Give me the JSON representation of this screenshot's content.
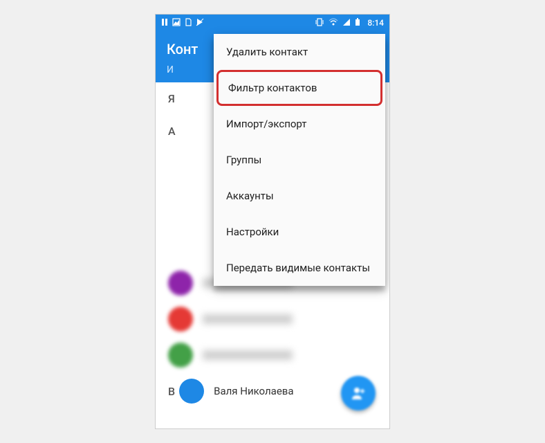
{
  "status_bar": {
    "time": "8:14"
  },
  "header": {
    "title": "Конт"
  },
  "tabs": {
    "partial": "И"
  },
  "menu": {
    "items": [
      {
        "label": "Удалить контакт",
        "highlighted": false
      },
      {
        "label": "Фильтр контактов",
        "highlighted": true
      },
      {
        "label": "Импорт/экспорт",
        "highlighted": false
      },
      {
        "label": "Группы",
        "highlighted": false
      },
      {
        "label": "Аккаунты",
        "highlighted": false
      },
      {
        "label": "Настройки",
        "highlighted": false
      },
      {
        "label": "Передать видимые контакты",
        "highlighted": false
      }
    ]
  },
  "contacts": {
    "sections": [
      {
        "letter": "Я",
        "rows": []
      },
      {
        "letter": "A",
        "rows": [
          {
            "avatar_color": "purple",
            "blur": true
          },
          {
            "avatar_color": "red",
            "blur": true
          },
          {
            "avatar_color": "green",
            "blur": true
          }
        ]
      },
      {
        "letter": "B",
        "rows": [
          {
            "avatar_color": "blue",
            "name": "Валя Николаева"
          }
        ]
      }
    ]
  }
}
